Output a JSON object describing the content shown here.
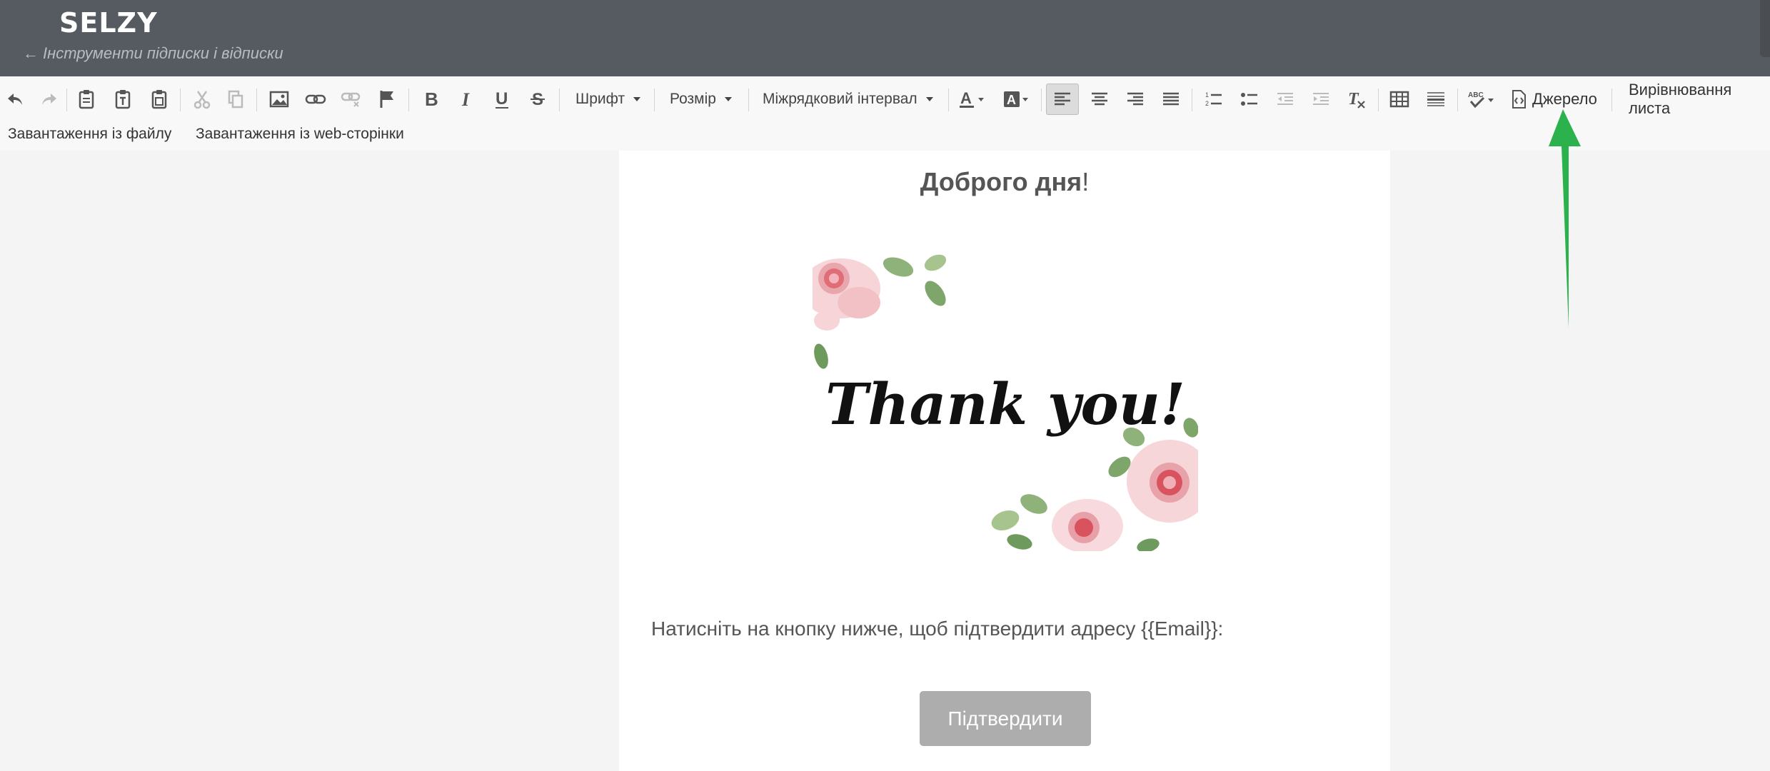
{
  "app": {
    "logo": "SELZY",
    "back_link": "Інструменти підписки і відписки",
    "back_arrow": "←"
  },
  "toolbar": {
    "font_label": "Шрифт",
    "size_label": "Розмір",
    "line_spacing_label": "Міжрядковий інтервал",
    "source_label": "Джерело",
    "align_letter_label": "Вирівнювання листа",
    "upload_file_label": "Завантаження із файлу",
    "upload_web_label": "Завантаження із web-сторінки",
    "active_align": "align-left"
  },
  "email": {
    "greeting": "Доброго дня",
    "greeting_mark": "!",
    "image_text": "Thank you!",
    "message": "Натисніть на кнопку нижче, щоб підтвердити адресу {{Email}}:",
    "confirm_button": "Підтвердити"
  },
  "colors": {
    "header_bg": "#565b61",
    "button_bg": "#adadad",
    "annotation_arrow": "#2bb24c"
  },
  "annotation": {
    "arrow_points_to": "source-button"
  }
}
